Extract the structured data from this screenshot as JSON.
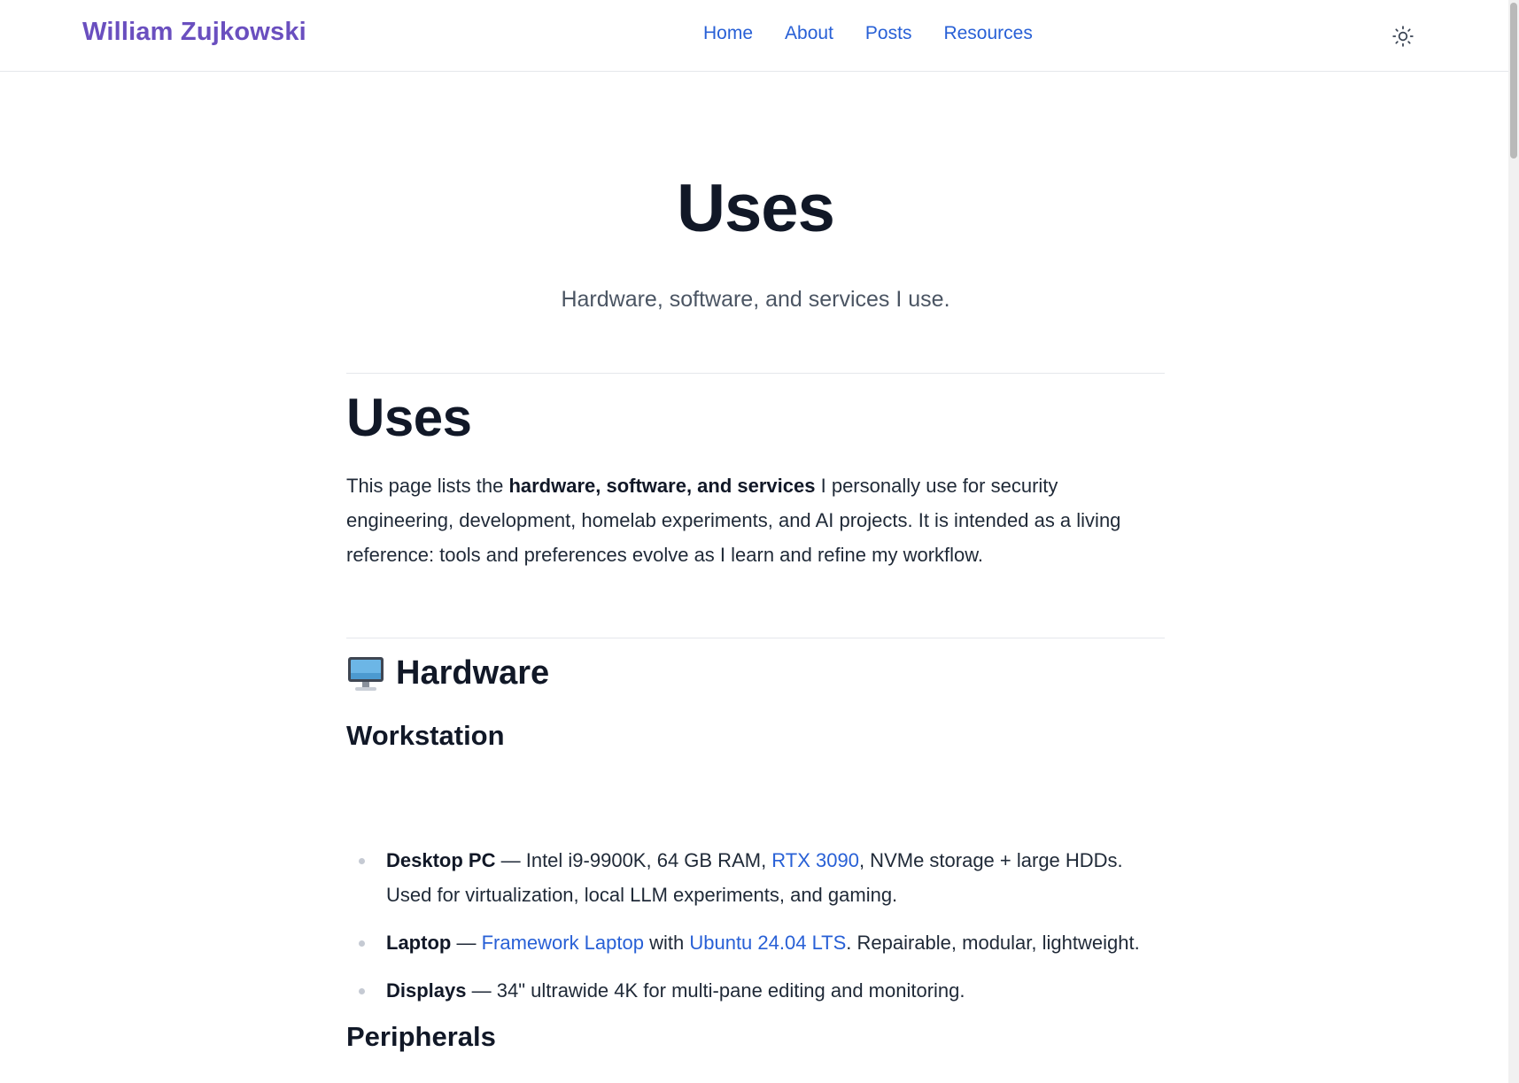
{
  "header": {
    "brand": "William Zujkowski",
    "nav": [
      {
        "label": "Home"
      },
      {
        "label": "About"
      },
      {
        "label": "Posts"
      },
      {
        "label": "Resources"
      }
    ],
    "theme_icon": "sun-icon"
  },
  "hero": {
    "title": "Uses",
    "subtitle": "Hardware, software, and services I use."
  },
  "article": {
    "title": "Uses",
    "intro": {
      "before": "This page lists the ",
      "bold": "hardware, software, and services",
      "after": " I personally use for security engineering, development, homelab experiments, and AI projects. It is intended as a living reference: tools and preferences evolve as I learn and refine my workflow."
    },
    "hardware": {
      "icon": "desktop-computer-icon",
      "heading": "Hardware",
      "workstation": {
        "heading": "Workstation",
        "items": [
          {
            "term": "Desktop PC",
            "sep": " — ",
            "t1": "Intel i9-9900K, 64 GB RAM, ",
            "link1": "RTX 3090",
            "t2": ", NVMe storage + large HDDs. Used for virtualization, local LLM experiments, and gaming."
          },
          {
            "term": "Laptop",
            "sep": " — ",
            "link1": "Framework Laptop",
            "t1": " with ",
            "link2": "Ubuntu 24.04 LTS",
            "t2": ". Repairable, modular, lightweight."
          },
          {
            "term": "Displays",
            "sep": " — ",
            "t1": "34\" ultrawide 4K for multi-pane editing and monitoring."
          }
        ]
      },
      "peripherals": {
        "heading": "Peripherals"
      }
    }
  },
  "colors": {
    "brand": "#6a4fbf",
    "link": "#2860d6",
    "heading": "#111827",
    "body": "#1f2937",
    "muted": "#4b5563",
    "border": "#e5e7eb"
  }
}
